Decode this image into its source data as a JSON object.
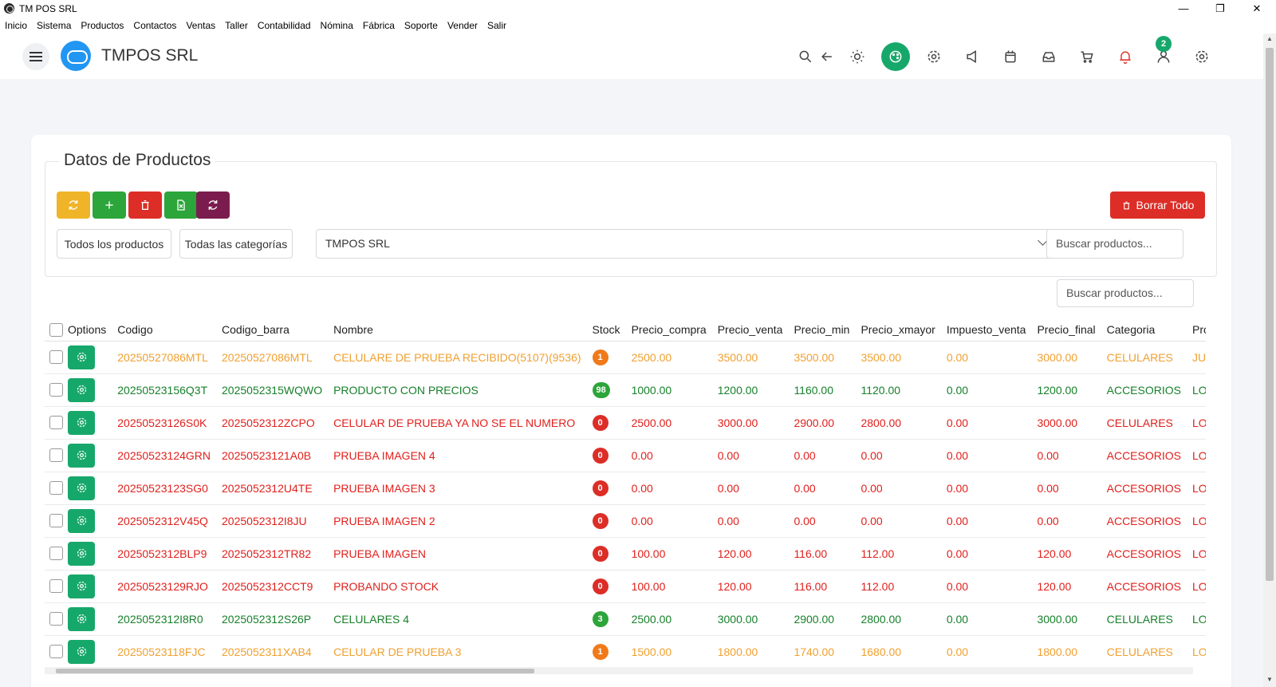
{
  "window": {
    "title": "TM POS SRL",
    "minimize": "—",
    "restore": "❐",
    "close": "✕"
  },
  "menu": [
    "Inicio",
    "Sistema",
    "Productos",
    "Contactos",
    "Ventas",
    "Taller",
    "Contabilidad",
    "Nómina",
    "Fábrica",
    "Soporte",
    "Vender",
    "Salir"
  ],
  "header": {
    "brand": "TMPOS SRL",
    "notification_count": "2",
    "icons": [
      "search-icon",
      "back-arrow-icon",
      "sun-icon",
      "palette-icon",
      "settings-icon",
      "megaphone-icon",
      "calendar-icon",
      "inbox-icon",
      "cart-icon",
      "bell-icon",
      "user-icon",
      "gear-icon"
    ]
  },
  "card": {
    "legend": "Datos de Productos",
    "toolbar": {
      "buttons": [
        {
          "name": "refresh-button",
          "icon": "refresh-icon",
          "color": "#f0b429"
        },
        {
          "name": "add-button",
          "icon": "plus-icon",
          "color": "#2ca53a"
        },
        {
          "name": "delete-button",
          "icon": "trash-icon",
          "color": "#dc2e27"
        },
        {
          "name": "excel-button",
          "icon": "excel-file-icon",
          "color": "#2ca53a"
        },
        {
          "name": "sync-button",
          "icon": "sync-icon",
          "color": "#7a1d4e"
        }
      ],
      "borrar_todo": "Borrar Todo"
    },
    "filters": {
      "all_products": "Todos los productos",
      "all_categories": "Todas las categorías",
      "company": "TMPOS SRL",
      "search_placeholder": "Buscar productos..."
    },
    "table_search_placeholder": "Buscar productos..."
  },
  "table": {
    "columns": [
      "Options",
      "Codigo",
      "Codigo_barra",
      "Nombre",
      "Stock",
      "Precio_compra",
      "Precio_venta",
      "Precio_min",
      "Precio_xmayor",
      "Impuesto_venta",
      "Precio_final",
      "Categoria",
      "Proveedor"
    ],
    "rows": [
      {
        "status": "orange",
        "codigo": "20250527086MTL",
        "codigo_barra": "20250527086MTL",
        "nombre": "CELULARE DE PRUEBA RECIBIDO(5107)(9536)",
        "stock": "1",
        "precio_compra": "2500.00",
        "precio_venta": "3500.00",
        "precio_min": "3500.00",
        "precio_xmayor": "3500.00",
        "impuesto_venta": "0.00",
        "precio_final": "3000.00",
        "categoria": "CELULARES",
        "proveedor": "JUANITO"
      },
      {
        "status": "green",
        "codigo": "20250523156Q3T",
        "codigo_barra": "2025052315WQWO",
        "nombre": "PRODUCTO CON PRECIOS",
        "stock": "98",
        "precio_compra": "1000.00",
        "precio_venta": "1200.00",
        "precio_min": "1160.00",
        "precio_xmayor": "1120.00",
        "impuesto_venta": "0.00",
        "precio_final": "1200.00",
        "categoria": "ACCESORIOS",
        "proveedor": "LOCAL"
      },
      {
        "status": "red",
        "codigo": "20250523126S0K",
        "codigo_barra": "2025052312ZCPO",
        "nombre": "CELULAR DE PRUEBA YA NO SE EL NUMERO",
        "stock": "0",
        "precio_compra": "2500.00",
        "precio_venta": "3000.00",
        "precio_min": "2900.00",
        "precio_xmayor": "2800.00",
        "impuesto_venta": "0.00",
        "precio_final": "3000.00",
        "categoria": "CELULARES",
        "proveedor": "LOCAL"
      },
      {
        "status": "red",
        "codigo": "20250523124GRN",
        "codigo_barra": "20250523121A0B",
        "nombre": "PRUEBA IMAGEN 4",
        "stock": "0",
        "precio_compra": "0.00",
        "precio_venta": "0.00",
        "precio_min": "0.00",
        "precio_xmayor": "0.00",
        "impuesto_venta": "0.00",
        "precio_final": "0.00",
        "categoria": "ACCESORIOS",
        "proveedor": "LOCAL"
      },
      {
        "status": "red",
        "codigo": "20250523123SG0",
        "codigo_barra": "2025052312U4TE",
        "nombre": "PRUEBA IMAGEN 3",
        "stock": "0",
        "precio_compra": "0.00",
        "precio_venta": "0.00",
        "precio_min": "0.00",
        "precio_xmayor": "0.00",
        "impuesto_venta": "0.00",
        "precio_final": "0.00",
        "categoria": "ACCESORIOS",
        "proveedor": "LOCAL"
      },
      {
        "status": "red",
        "codigo": "2025052312V45Q",
        "codigo_barra": "2025052312I8JU",
        "nombre": "PRUEBA IMAGEN 2",
        "stock": "0",
        "precio_compra": "0.00",
        "precio_venta": "0.00",
        "precio_min": "0.00",
        "precio_xmayor": "0.00",
        "impuesto_venta": "0.00",
        "precio_final": "0.00",
        "categoria": "ACCESORIOS",
        "proveedor": "LOCAL"
      },
      {
        "status": "red",
        "codigo": "2025052312BLP9",
        "codigo_barra": "2025052312TR82",
        "nombre": "PRUEBA IMAGEN",
        "stock": "0",
        "precio_compra": "100.00",
        "precio_venta": "120.00",
        "precio_min": "116.00",
        "precio_xmayor": "112.00",
        "impuesto_venta": "0.00",
        "precio_final": "120.00",
        "categoria": "ACCESORIOS",
        "proveedor": "LOCAL"
      },
      {
        "status": "red",
        "codigo": "20250523129RJO",
        "codigo_barra": "2025052312CCT9",
        "nombre": "PROBANDO STOCK",
        "stock": "0",
        "precio_compra": "100.00",
        "precio_venta": "120.00",
        "precio_min": "116.00",
        "precio_xmayor": "112.00",
        "impuesto_venta": "0.00",
        "precio_final": "120.00",
        "categoria": "ACCESORIOS",
        "proveedor": "LOCAL"
      },
      {
        "status": "green",
        "codigo": "2025052312I8R0",
        "codigo_barra": "2025052312S26P",
        "nombre": "CELULARES 4",
        "stock": "3",
        "precio_compra": "2500.00",
        "precio_venta": "3000.00",
        "precio_min": "2900.00",
        "precio_xmayor": "2800.00",
        "impuesto_venta": "0.00",
        "precio_final": "3000.00",
        "categoria": "CELULARES",
        "proveedor": "LOCAL"
      },
      {
        "status": "orange",
        "codigo": "20250523118FJC",
        "codigo_barra": "2025052311XAB4",
        "nombre": "CELULAR DE PRUEBA 3",
        "stock": "1",
        "precio_compra": "1500.00",
        "precio_venta": "1800.00",
        "precio_min": "1740.00",
        "precio_xmayor": "1680.00",
        "impuesto_venta": "0.00",
        "precio_final": "1800.00",
        "categoria": "CELULARES",
        "proveedor": "LOCAL"
      }
    ]
  },
  "colors": {
    "orange": "#f0a030",
    "green": "#17802b",
    "red": "#e0201c",
    "badge_orange": "#f07a1a",
    "badge_green": "#2ca53a",
    "badge_red": "#dc2e27"
  }
}
